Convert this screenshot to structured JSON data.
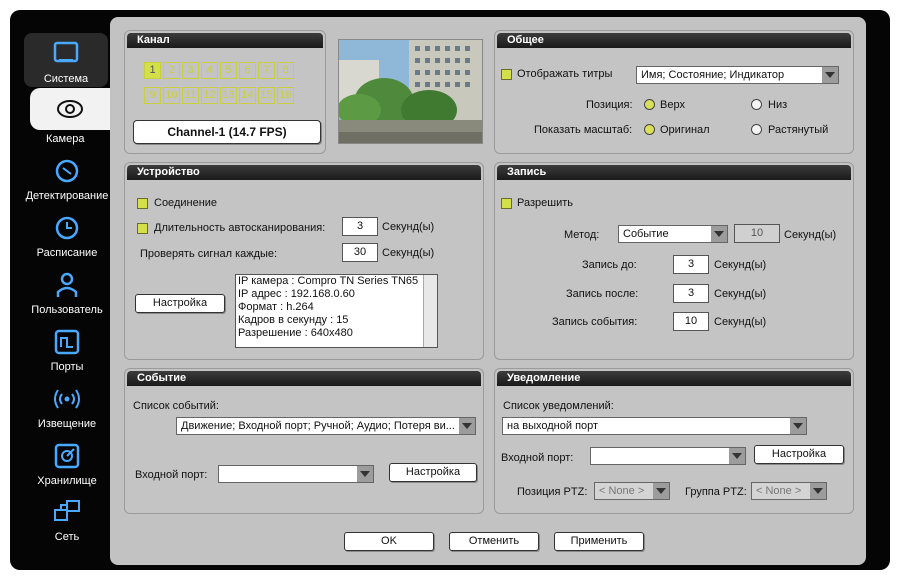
{
  "sidebar": {
    "items": [
      {
        "label": "Система",
        "icon": "monitor-icon"
      },
      {
        "label": "Камера",
        "icon": "eye-icon"
      },
      {
        "label": "Детектирование",
        "icon": "motion-detect-icon"
      },
      {
        "label": "Расписание",
        "icon": "clock-icon"
      },
      {
        "label": "Пользователь",
        "icon": "user-icon"
      },
      {
        "label": "Порты",
        "icon": "ports-icon"
      },
      {
        "label": "Извещение",
        "icon": "broadcast-icon"
      },
      {
        "label": "Хранилище",
        "icon": "storage-icon"
      },
      {
        "label": "Сеть",
        "icon": "network-icon"
      }
    ]
  },
  "channel": {
    "title": "Канал",
    "buttons": [
      "1",
      "2",
      "3",
      "4",
      "5",
      "6",
      "7",
      "8",
      "9",
      "10",
      "11",
      "12",
      "13",
      "14",
      "15",
      "16"
    ],
    "selected": "1",
    "display": "Channel-1 (14.7 FPS)"
  },
  "general": {
    "title": "Общее",
    "show_titles_label": "Отображать титры",
    "titles_value": "Имя; Состояние; Индикатор",
    "position_label": "Позиция:",
    "position_top": "Верх",
    "position_bottom": "Низ",
    "scale_label": "Показать масштаб:",
    "scale_original": "Оригинал",
    "scale_stretched": "Растянутый"
  },
  "device": {
    "title": "Устройство",
    "connection_label": "Соединение",
    "autoscan_label": "Длительность автосканирования:",
    "autoscan_value": "3",
    "seconds_label": "Секунд(ы)",
    "signal_label": "Проверять сигнал каждые:",
    "signal_value": "30",
    "setup_button": "Настройка",
    "info_lines": [
      "IP камера : Compro TN Series TN65",
      "IP адрес : 192.168.0.60",
      "Формат : h.264",
      "Кадров в секунду : 15",
      "Разрешение : 640x480"
    ]
  },
  "record": {
    "title": "Запись",
    "enable_label": "Разрешить",
    "method_label": "Метод:",
    "method_value": "Событие",
    "method_seconds": "10",
    "pre_label": "Запись до:",
    "pre_value": "3",
    "post_label": "Запись после:",
    "post_value": "3",
    "event_label": "Запись события:",
    "event_value": "10",
    "seconds_label": "Секунд(ы)"
  },
  "event": {
    "title": "Событие",
    "list_label": "Список событий:",
    "list_value": "Движение; Входной порт; Ручной; Аудио; Потеря ви...",
    "input_port_label": "Входной порт:",
    "input_port_value": "",
    "setup_button": "Настройка"
  },
  "notify": {
    "title": "Уведомление",
    "list_label": "Список уведомлений:",
    "list_value": "на выходной порт",
    "input_port_label": "Входной порт:",
    "input_port_value": "",
    "setup_button": "Настройка",
    "ptz_pos_label": "Позиция PTZ:",
    "ptz_pos_value": "< None >",
    "ptz_group_label": "Группа PTZ:",
    "ptz_group_value": "< None >"
  },
  "footer": {
    "ok": "OK",
    "cancel": "Отменить",
    "apply": "Применить"
  },
  "colors": {
    "accent": "#d4e04a",
    "panel": "#c4c4c4",
    "frame": "#050505"
  }
}
